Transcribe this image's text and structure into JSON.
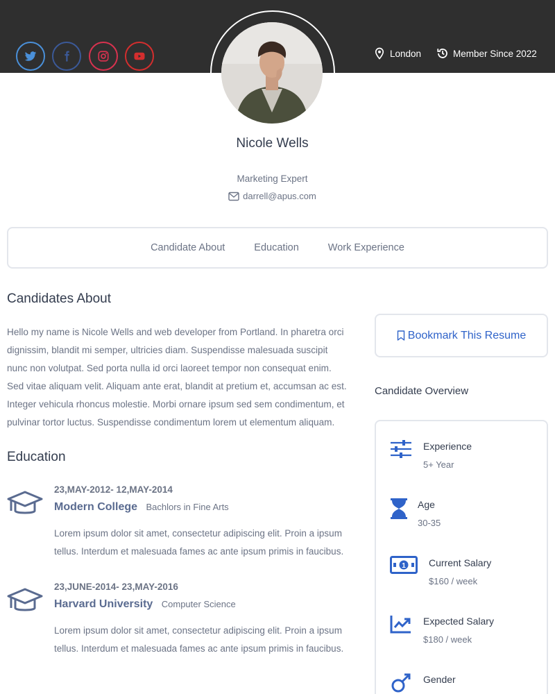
{
  "header": {
    "social": [
      {
        "name": "twitter-icon",
        "color": "#4a90d9"
      },
      {
        "name": "facebook-icon",
        "color": "#3b5998"
      },
      {
        "name": "instagram-icon",
        "color": "#d9324f"
      },
      {
        "name": "youtube-icon",
        "color": "#d42e2e"
      }
    ],
    "location": "London",
    "member_since": "Member Since 2022"
  },
  "profile": {
    "name": "Nicole Wells",
    "role": "Marketing Expert",
    "email": "darrell@apus.com"
  },
  "tabs": [
    "Candidate About",
    "Education",
    "Work Experience"
  ],
  "about": {
    "heading": "Candidates About",
    "text": "Hello my name is Nicole Wells and web developer from Portland. In pharetra orci dignissim, blandit mi semper, ultricies diam. Suspendisse malesuada suscipit nunc non volutpat. Sed porta nulla id orci laoreet tempor non consequat enim. Sed vitae aliquam velit. Aliquam ante erat, blandit at pretium et, accumsan ac est. Integer vehicula rhoncus molestie. Morbi ornare ipsum sed sem condimentum, et pulvinar tortor luctus. Suspendisse condimentum lorem ut elementum aliquam."
  },
  "education": {
    "heading": "Education",
    "items": [
      {
        "dates": "23,MAY-2012- 12,MAY-2014",
        "school": "Modern College",
        "degree": "Bachlors in Fine Arts",
        "description": "Lorem ipsum dolor sit amet, consectetur adipiscing elit. Proin a ipsum tellus. Interdum et malesuada fames ac ante ipsum primis in faucibus."
      },
      {
        "dates": "23,JUNE-2014- 23,MAY-2016",
        "school": "Harvard University",
        "degree": "Computer Science",
        "description": "Lorem ipsum dolor sit amet, consectetur adipiscing elit. Proin a ipsum tellus. Interdum et malesuada fames ac ante ipsum primis in faucibus."
      }
    ]
  },
  "sidebar": {
    "bookmark_label": "Bookmark This Resume",
    "overview_title": "Candidate Overview",
    "overview": [
      {
        "icon": "sliders-icon",
        "label": "Experience",
        "value": "5+ Year"
      },
      {
        "icon": "hourglass-icon",
        "label": "Age",
        "value": "30-35"
      },
      {
        "icon": "banknote-icon",
        "label": "Current Salary",
        "value": "$160 / week"
      },
      {
        "icon": "trend-chart-icon",
        "label": "Expected Salary",
        "value": "$180 / week"
      },
      {
        "icon": "gender-icon",
        "label": "Gender",
        "value": ""
      }
    ]
  },
  "colors": {
    "header_bg": "#2f2f2f",
    "accent_blue": "#2f63c9",
    "text_dark": "#333c4e",
    "text_muted": "#6b7385"
  }
}
